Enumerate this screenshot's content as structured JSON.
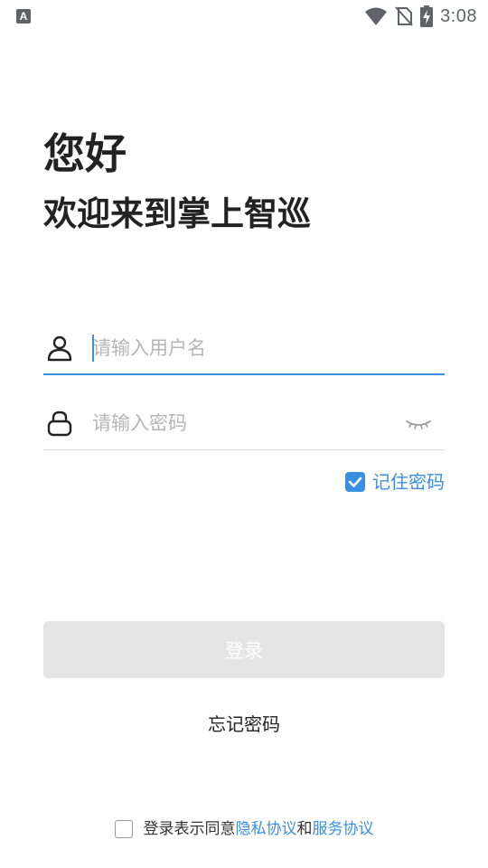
{
  "status_bar": {
    "app_icon_letter": "A",
    "time": "3:08"
  },
  "header": {
    "greeting": "您好",
    "welcome": "欢迎来到掌上智巡"
  },
  "username_field": {
    "placeholder": "请输入用户名",
    "value": "",
    "icon": "user-icon"
  },
  "password_field": {
    "placeholder": "请输入密码",
    "value": "",
    "icon": "lock-icon",
    "toggle_icon": "eye-closed-icon"
  },
  "remember": {
    "label": "记住密码",
    "checked": true
  },
  "login_button": {
    "label": "登录"
  },
  "forgot_password": {
    "label": "忘记密码"
  },
  "agreement": {
    "checked": false,
    "prefix": "登录表示同意",
    "privacy_link": "隐私协议",
    "conjunction": "和",
    "service_link": "服务协议"
  },
  "colors": {
    "accent": "#3b8fe0",
    "button_disabled": "#e5e5e5",
    "text_primary": "#222222",
    "placeholder": "#b5b5b5"
  }
}
